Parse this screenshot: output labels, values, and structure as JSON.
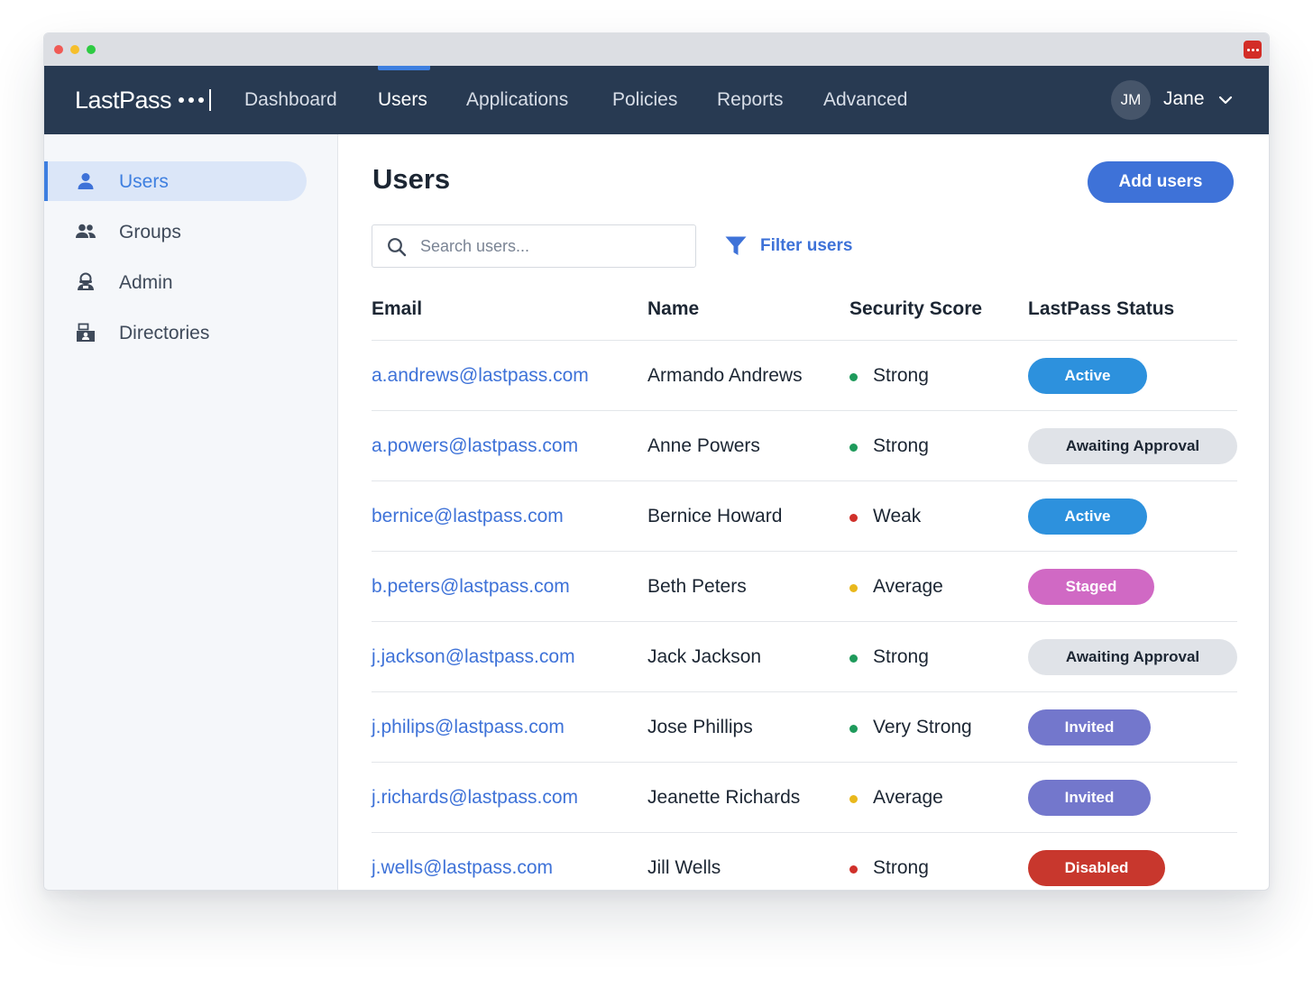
{
  "browser": {
    "extension_icon": "lastpass-extension-icon"
  },
  "logo": {
    "text": "LastPass"
  },
  "nav": {
    "items": [
      {
        "label": "Dashboard",
        "active": false
      },
      {
        "label": "Users",
        "active": true
      },
      {
        "label": "Applications",
        "active": false
      },
      {
        "label": "Policies",
        "active": false
      },
      {
        "label": "Reports",
        "active": false
      },
      {
        "label": "Advanced",
        "active": false
      }
    ],
    "user": {
      "initials": "JM",
      "name": "Jane"
    }
  },
  "sidebar": {
    "items": [
      {
        "label": "Users",
        "icon": "user-icon",
        "active": true
      },
      {
        "label": "Groups",
        "icon": "groups-icon",
        "active": false
      },
      {
        "label": "Admin",
        "icon": "admin-icon",
        "active": false
      },
      {
        "label": "Directories",
        "icon": "directories-icon",
        "active": false
      }
    ]
  },
  "main": {
    "title": "Users",
    "add_button": "Add users",
    "search": {
      "placeholder": "Search users...",
      "value": ""
    },
    "filter_label": "Filter users",
    "columns": [
      "Email",
      "Name",
      "Security Score",
      "LastPass Status"
    ]
  },
  "users": [
    {
      "email": "a.andrews@lastpass.com",
      "name": "Armando Andrews",
      "score": "Strong",
      "score_color": "#1e9a5b",
      "status": "Active",
      "status_bg": "#2d91dd",
      "status_fg": "#ffffff"
    },
    {
      "email": "a.powers@lastpass.com",
      "name": "Anne Powers",
      "score": "Strong",
      "score_color": "#1e9a5b",
      "status": "Awaiting Approval",
      "status_bg": "#e0e3e8",
      "status_fg": "#1c2633"
    },
    {
      "email": "bernice@lastpass.com",
      "name": "Bernice Howard",
      "score": "Weak",
      "score_color": "#d0302a",
      "status": "Active",
      "status_bg": "#2d91dd",
      "status_fg": "#ffffff"
    },
    {
      "email": "b.peters@lastpass.com",
      "name": "Beth Peters",
      "score": "Average",
      "score_color": "#e9b81c",
      "status": "Staged",
      "status_bg": "#d069c4",
      "status_fg": "#ffffff"
    },
    {
      "email": "j.jackson@lastpass.com",
      "name": "Jack Jackson",
      "score": "Strong",
      "score_color": "#1e9a5b",
      "status": "Awaiting Approval",
      "status_bg": "#e0e3e8",
      "status_fg": "#1c2633"
    },
    {
      "email": "j.philips@lastpass.com",
      "name": "Jose Phillips",
      "score": "Very Strong",
      "score_color": "#1e9a5b",
      "status": "Invited",
      "status_bg": "#7377cc",
      "status_fg": "#ffffff"
    },
    {
      "email": "j.richards@lastpass.com",
      "name": "Jeanette Richards",
      "score": "Average",
      "score_color": "#e9b81c",
      "status": "Invited",
      "status_bg": "#7377cc",
      "status_fg": "#ffffff"
    },
    {
      "email": "j.wells@lastpass.com",
      "name": "Jill Wells",
      "score": "Strong",
      "score_color": "#d0302a",
      "status": "Disabled",
      "status_bg": "#c8372d",
      "status_fg": "#ffffff"
    }
  ],
  "colors": {
    "nav_bg": "#283a52",
    "accent": "#3e72d8",
    "sidebar_bg": "#f5f7fa"
  }
}
